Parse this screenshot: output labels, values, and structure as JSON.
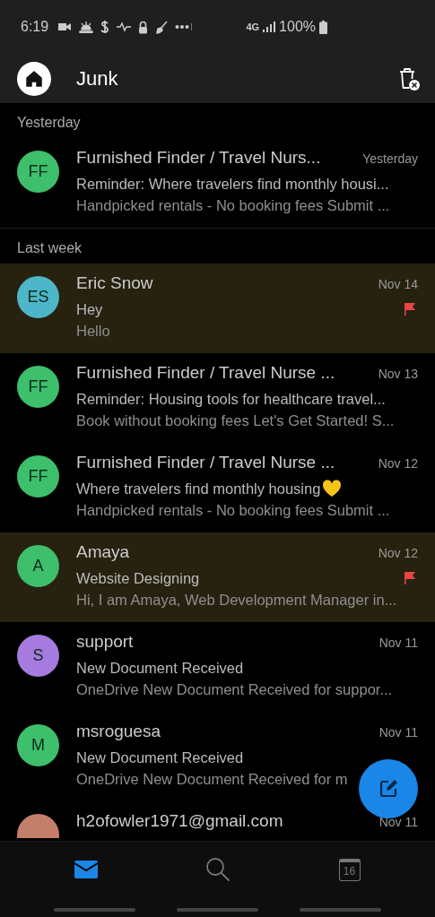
{
  "status_bar": {
    "time": "6:19",
    "network": "4G",
    "battery": "100%"
  },
  "header": {
    "title": "Junk"
  },
  "sections": [
    {
      "label": "Yesterday",
      "messages": [
        {
          "initials": "FF",
          "color": "#3dbf6b",
          "sender": "Furnished Finder / Travel Nurs...",
          "date": "Yesterday",
          "subject": "Reminder: Where travelers find monthly housi...",
          "preview": "Handpicked rentals - No booking fees Submit ...",
          "flagged": false
        }
      ]
    },
    {
      "label": "Last week",
      "messages": [
        {
          "initials": "ES",
          "color": "#4db6c8",
          "sender": "Eric Snow",
          "date": "Nov 14",
          "subject": "Hey",
          "preview": "Hello",
          "flagged": true
        },
        {
          "initials": "FF",
          "color": "#3dbf6b",
          "sender": "Furnished Finder / Travel Nurse ...",
          "date": "Nov 13",
          "subject": "Reminder: Housing tools for healthcare travel...",
          "preview": "Book without booking fees Let's Get Started! S...",
          "flagged": false
        },
        {
          "initials": "FF",
          "color": "#3dbf6b",
          "sender": "Furnished Finder / Travel Nurse ...",
          "date": "Nov 12",
          "subject": "Where travelers find monthly housing",
          "heart": true,
          "preview": "Handpicked rentals - No booking fees Submit ...",
          "flagged": false
        },
        {
          "initials": "A",
          "color": "#3dbf6b",
          "sender": "Amaya",
          "date": "Nov 12",
          "subject": "Website Designing",
          "preview": "Hi, I am Amaya, Web Development Manager in...",
          "flagged": true
        },
        {
          "initials": "S",
          "color": "#a57be0",
          "sender": "support",
          "date": "Nov 11",
          "subject": "New Document Received",
          "preview": "OneDrive New Document Received for suppor...",
          "flagged": false
        },
        {
          "initials": "M",
          "color": "#3dbf6b",
          "sender": "msroguesa",
          "date": "Nov 11",
          "subject": "New Document Received",
          "preview": "OneDrive New Document Received for m",
          "flagged": false
        },
        {
          "color": "#c47f6a",
          "sender": "h2ofowler1971@gmail.com",
          "date": "Nov 11",
          "flagged": false
        }
      ]
    }
  ],
  "nav_tabs": [
    {
      "kind": "mail",
      "selected": true
    },
    {
      "kind": "search",
      "selected": false
    },
    {
      "kind": "calendar",
      "label": "16",
      "selected": false
    }
  ]
}
